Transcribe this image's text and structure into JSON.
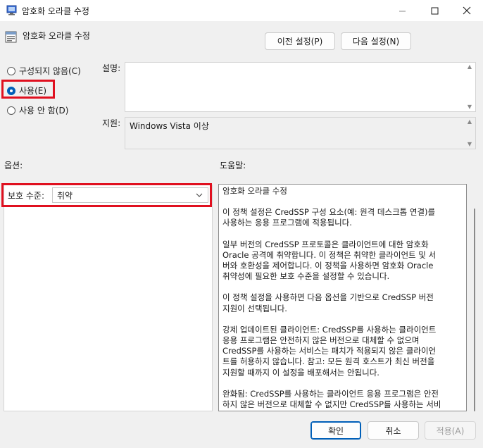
{
  "window": {
    "title": "암호화 오라클 수정",
    "icon": "policy-window-icon"
  },
  "header": {
    "policy_title": "암호화 오라클 수정",
    "prev_button": "이전 설정(P)",
    "next_button": "다음 설정(N)"
  },
  "state": {
    "not_configured": "구성되지 않음(C)",
    "enabled": "사용(E)",
    "disabled": "사용 안 함(D)",
    "selected": "enabled"
  },
  "labels": {
    "comment": "설명:",
    "supported_on": "지원:",
    "options": "옵션:",
    "help": "도움말:"
  },
  "comment_value": "",
  "supported_on_value": "Windows Vista 이상",
  "options": {
    "protection_level_label": "보호 수준:",
    "protection_level_value": "취약"
  },
  "help_text": [
    "암호화 오라클 수정",
    "이 정책 설정은 CredSSP 구성 요소(예: 원격 데스크톱 연결)를\n사용하는 응용 프로그램에 적용됩니다.",
    "일부 버전의 CredSSP 프로토콜은 클라이언트에 대한 암호화\nOracle 공격에 취약합니다.  이 정책은 취약한 클라이언트 및 서\n버와 호환성을 제어합니다.  이 정책을 사용하면 암호화 Oracle\n취약성에 필요한 보호 수준을 설정할 수 있습니다.",
    "이 정책 설정을 사용하면 다음 옵션을 기반으로 CredSSP 버전\n지원이 선택됩니다.",
    "강제 업데이트된 클라이언트: CredSSP를 사용하는 클라이언트\n응용 프로그램은 안전하지 않은 버전으로 대체할 수 없으며\nCredSSP를 사용하는 서비스는 패치가 적용되지 않은 클라이언\n트를 허용하지 않습니다. 참고: 모든 원격 호스트가 최신 버전을\n지원할 때까지 이 설정을 배포해서는 안됩니다.",
    "완화됨: CredSSP를 사용하는 클라이언트 응용 프로그램은 안전\n하지 않은 버전으로 대체할 수 없지만 CredSSP를 사용하는 서비\n스는 패치가 적용되지 않은 클라이언트를 허용합니다. 패치가 적"
  ],
  "footer": {
    "ok": "확인",
    "cancel": "취소",
    "apply": "적용(A)"
  }
}
